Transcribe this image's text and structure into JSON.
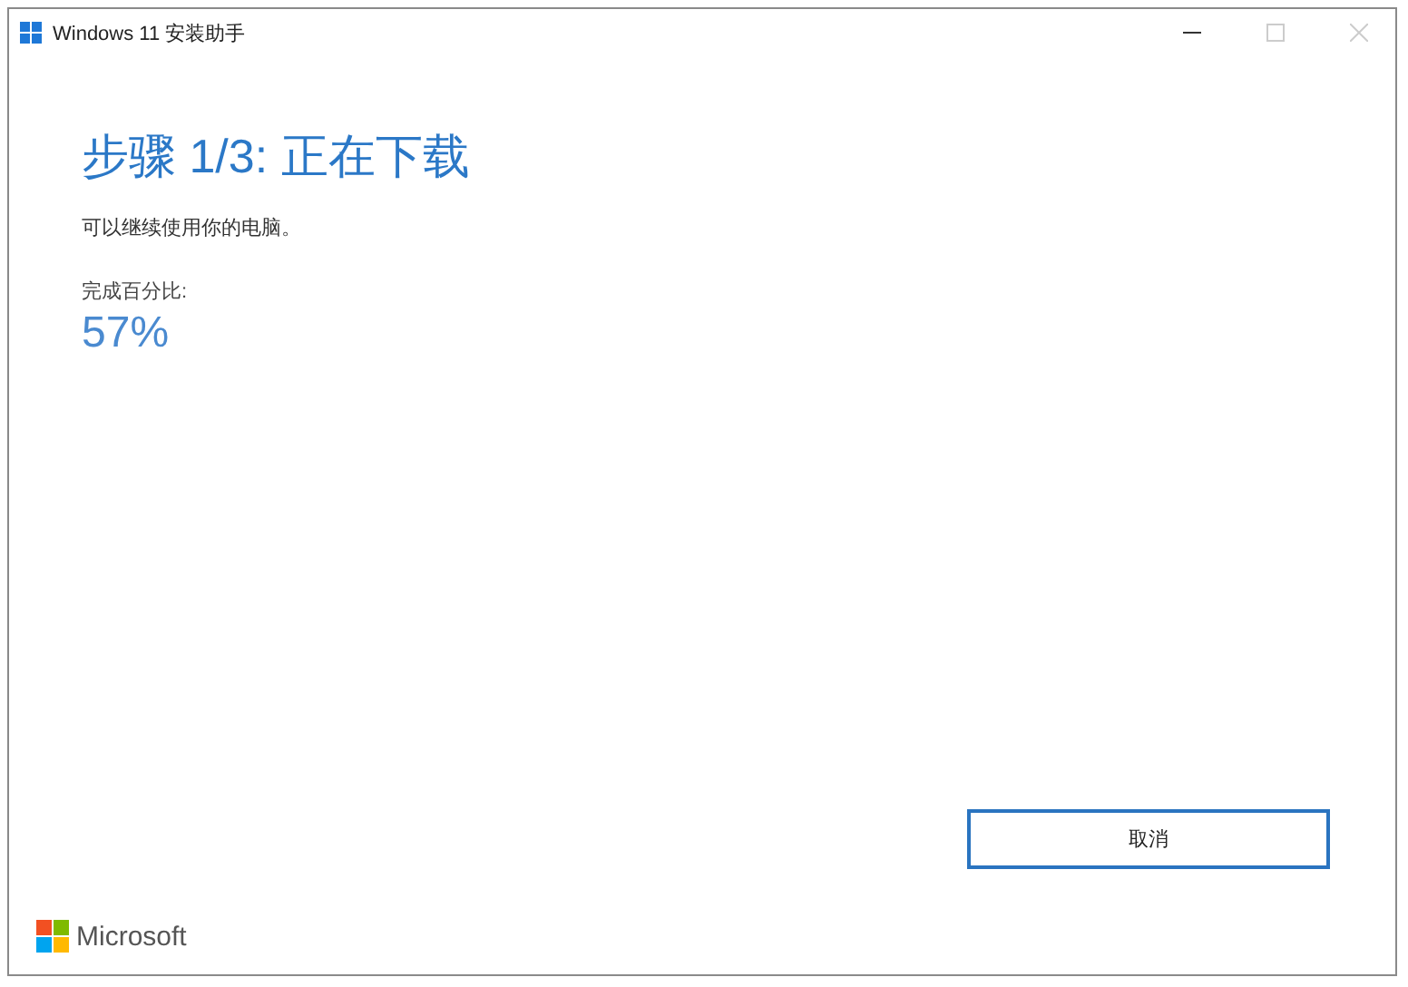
{
  "window": {
    "title": "Windows 11 安装助手"
  },
  "heading": "步骤 1/3: 正在下载",
  "subtitle": "可以继续使用你的电脑。",
  "progress": {
    "label": "完成百分比:",
    "value": "57%"
  },
  "buttons": [
    {
      "label": "取消"
    }
  ],
  "footer": {
    "brand": "Microsoft"
  }
}
